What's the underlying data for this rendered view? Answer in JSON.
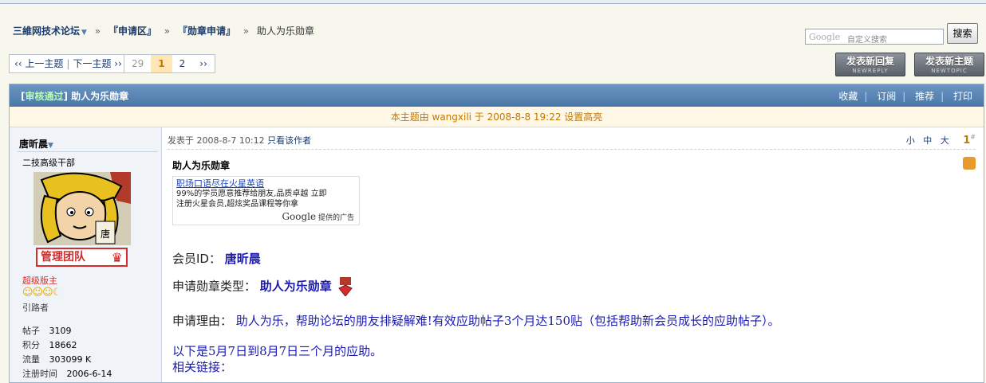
{
  "breadcrumb": {
    "forum": "三維网技术论坛",
    "sep1": "»",
    "section": "『申请区』",
    "sep2": "»",
    "subsection": "『勋章申请』",
    "sep3": "»",
    "current": "助人为乐勋章"
  },
  "search": {
    "logo": "Google",
    "placeholder": "自定义搜索",
    "button": "搜索"
  },
  "nav": {
    "prev": "‹‹ 上一主题",
    "next": "下一主题 ››",
    "pages": [
      "29",
      "1",
      "2",
      "››"
    ],
    "current_page": "1"
  },
  "buttons": {
    "reply": "发表新回复",
    "reply_sub": "NEWREPLY",
    "newtopic": "发表新主题",
    "newtopic_sub": "NEWTOPIC"
  },
  "thread": {
    "status_tag": "审核通过",
    "title": "助人为乐勋章",
    "ops": [
      "收藏",
      "订阅",
      "推荐",
      "打印"
    ],
    "highlight_notice": "本主题由 wangxili 于 2008-8-8 19:22 设置高亮"
  },
  "user": {
    "name": "唐昕晨",
    "title": "二技高级干部",
    "team_badge": "管理团队",
    "rank": "超级版主",
    "sub_rank": "引路者",
    "stats": [
      {
        "label": "帖子",
        "value": "3109"
      },
      {
        "label": "积分",
        "value": "18662"
      },
      {
        "label": "流量",
        "value": "303099 K"
      },
      {
        "label": "注册时间",
        "value": "2006-6-14"
      }
    ]
  },
  "post": {
    "posted_at": "发表于 2008-8-7 10:12",
    "author_only": "只看该作者",
    "font_sizes": [
      "小",
      "中",
      "大"
    ],
    "floor": "1",
    "floor_sup": "#",
    "title": "助人为乐勋章",
    "ad": {
      "line1": "职场口语尽在火星英语",
      "line2": "99%的学员愿意推荐给朋友,品质卓越  立即",
      "line3": "注册火星会员,超炫奖品课程等你拿",
      "brand": "Google",
      "brand_suffix": "提供的广告"
    },
    "member_id_label": "会员ID：",
    "member_id_value": "唐昕晨",
    "medal_type_label": "申请勋章类型：",
    "medal_type_value": "助人为乐勋章",
    "reason_label": "申请理由：",
    "reason_value": "助人为乐，帮助论坛的朋友排疑解难!有效应助帖子3个月达150贴（包括帮助新会员成长的应助帖子）。",
    "line_period": "以下是5月7日到8月7日三个月的应助。",
    "line_links": "相关链接："
  }
}
